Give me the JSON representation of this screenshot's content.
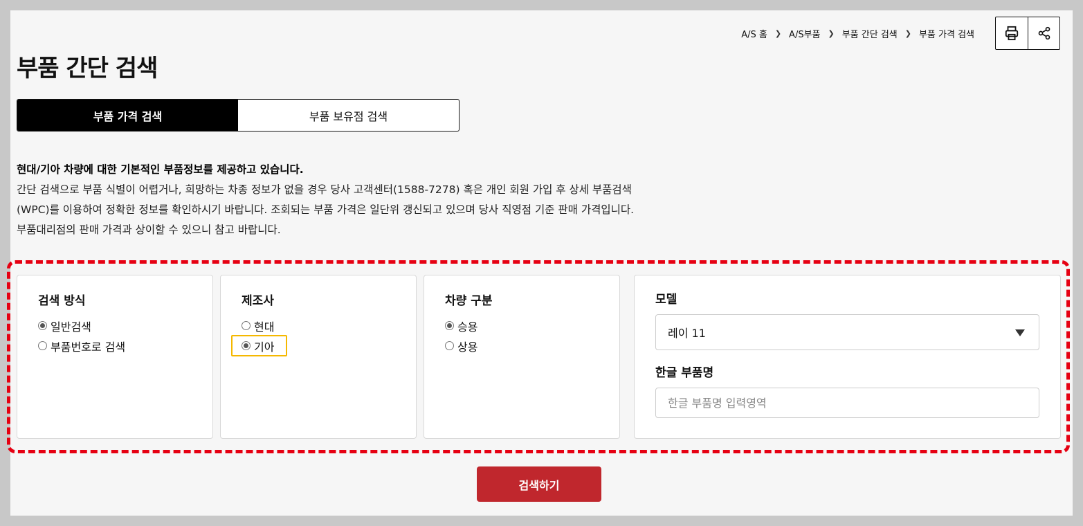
{
  "breadcrumb": [
    "A/S 홈",
    "A/S부품",
    "부품 간단 검색",
    "부품 가격 검색"
  ],
  "tools": {
    "print_icon": "printer-icon",
    "share_icon": "share-icon"
  },
  "page_title": "부품 간단 검색",
  "tabs": [
    {
      "label": "부품 가격 검색",
      "active": true
    },
    {
      "label": "부품 보유점 검색",
      "active": false
    }
  ],
  "intro": {
    "lead": "현대/기아 차량에 대한 기본적인 부품정보를 제공하고 있습니다.",
    "lines": [
      "간단 검색으로 부품 식별이 어렵거나, 희망하는 차종 정보가 없을 경우 당사 고객센터(1588-7278) 혹은 개인 회원 가입 후 상세 부품검색",
      "(WPC)를 이용하여 정확한 정보를 확인하시기 바랍니다. 조회되는 부품 가격은 일단위 갱신되고 있으며 당사 직영점 기준 판매 가격입니다.",
      "부품대리점의 판매 가격과 상이할 수 있으니 참고 바랍니다."
    ]
  },
  "search_method": {
    "title": "검색 방식",
    "options": [
      {
        "label": "일반검색",
        "checked": true
      },
      {
        "label": "부품번호로 검색",
        "checked": false
      }
    ]
  },
  "manufacturer": {
    "title": "제조사",
    "options": [
      {
        "label": "현대",
        "checked": false
      },
      {
        "label": "기아",
        "checked": true
      }
    ]
  },
  "vehicle_type": {
    "title": "차량 구분",
    "options": [
      {
        "label": "승용",
        "checked": true
      },
      {
        "label": "상용",
        "checked": false
      }
    ]
  },
  "model": {
    "title": "모델",
    "selected": "레이 11",
    "part_name_label": "한글 부품명",
    "part_name_placeholder": "한글 부품명 입력영역"
  },
  "search_button": "검색하기",
  "colors": {
    "accent_red": "#c0272d",
    "highlight_dashed": "#e60012",
    "highlight_yellow": "#f5b800"
  }
}
